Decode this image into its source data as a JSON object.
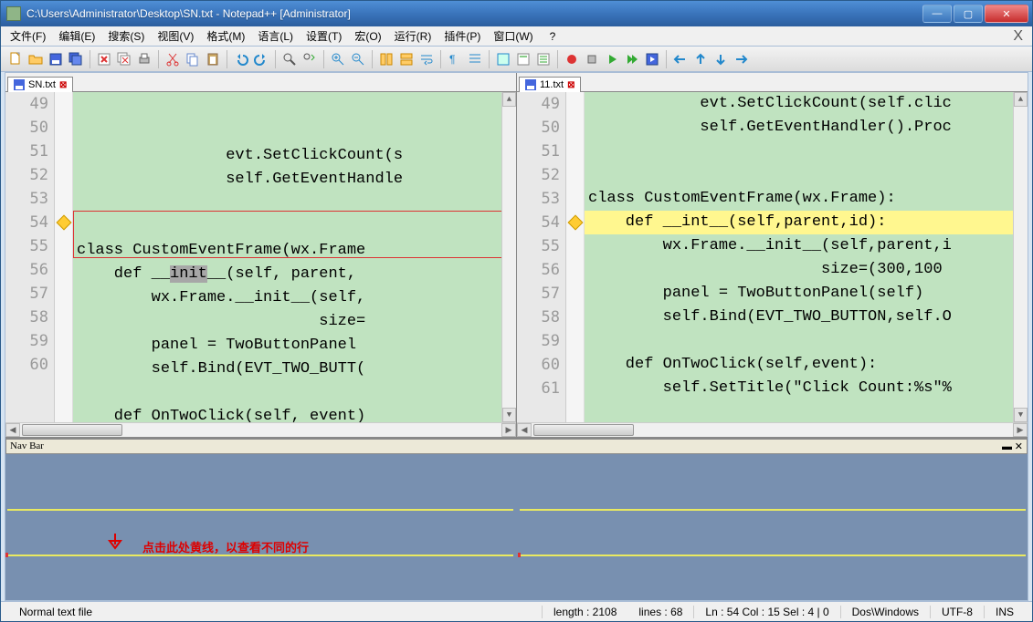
{
  "title": "C:\\Users\\Administrator\\Desktop\\SN.txt - Notepad++ [Administrator]",
  "menu": {
    "file": "文件(F)",
    "edit": "编辑(E)",
    "search": "搜索(S)",
    "view": "视图(V)",
    "format": "格式(M)",
    "language": "语言(L)",
    "settings": "设置(T)",
    "macro": "宏(O)",
    "run": "运行(R)",
    "plugins": "插件(P)",
    "window": "窗口(W)",
    "help": "?"
  },
  "tabs": {
    "left": "SN.txt",
    "right": "11.txt"
  },
  "left_lines": [
    {
      "n": "49",
      "txt": "                evt.SetClickCount(s"
    },
    {
      "n": "50",
      "txt": "                self.GetEventHandle"
    },
    {
      "n": "51",
      "txt": ""
    },
    {
      "n": "52",
      "txt": ""
    },
    {
      "n": "53",
      "txt": "class CustomEventFrame(wx.Frame"
    },
    {
      "n": "54",
      "txt": "    def __init__(self, parent,",
      "warn": true,
      "diff": true,
      "sel": "init"
    },
    {
      "n": "55",
      "txt": "        wx.Frame.__init__(self,"
    },
    {
      "n": "56",
      "txt": "                          size="
    },
    {
      "n": "57",
      "txt": "        panel = TwoButtonPanel"
    },
    {
      "n": "58",
      "txt": "        self.Bind(EVT_TWO_BUTT("
    },
    {
      "n": "59",
      "txt": ""
    },
    {
      "n": "60",
      "txt": "    def OnTwoClick(self, event)"
    }
  ],
  "right_lines": [
    {
      "n": "49",
      "txt": "            evt.SetClickCount(self.clic"
    },
    {
      "n": "50",
      "txt": "            self.GetEventHandler().Proc"
    },
    {
      "n": "51",
      "txt": ""
    },
    {
      "n": "52",
      "txt": ""
    },
    {
      "n": "53",
      "txt": "class CustomEventFrame(wx.Frame):"
    },
    {
      "n": "54",
      "txt": "    def __int__(self,parent,id):",
      "warn": true,
      "diff": true,
      "hl": true
    },
    {
      "n": "55",
      "txt": "        wx.Frame.__init__(self,parent,i"
    },
    {
      "n": "56",
      "txt": "                         size=(300,100"
    },
    {
      "n": "57",
      "txt": "        panel = TwoButtonPanel(self)"
    },
    {
      "n": "58",
      "txt": "        self.Bind(EVT_TWO_BUTTON,self.O"
    },
    {
      "n": "59",
      "txt": ""
    },
    {
      "n": "60",
      "txt": "    def OnTwoClick(self,event):"
    },
    {
      "n": "61",
      "txt": "        self.SetTitle(\"Click Count:%s\"%"
    }
  ],
  "navbar": {
    "label": "Nav Bar",
    "caption": "点击此处黄线，以查看不同的行"
  },
  "status": {
    "type": "Normal text file",
    "length": "length : 2108",
    "lines": "lines : 68",
    "pos": "Ln : 54    Col : 15    Sel : 4 | 0",
    "eol": "Dos\\Windows",
    "enc": "UTF-8",
    "ins": "INS"
  }
}
